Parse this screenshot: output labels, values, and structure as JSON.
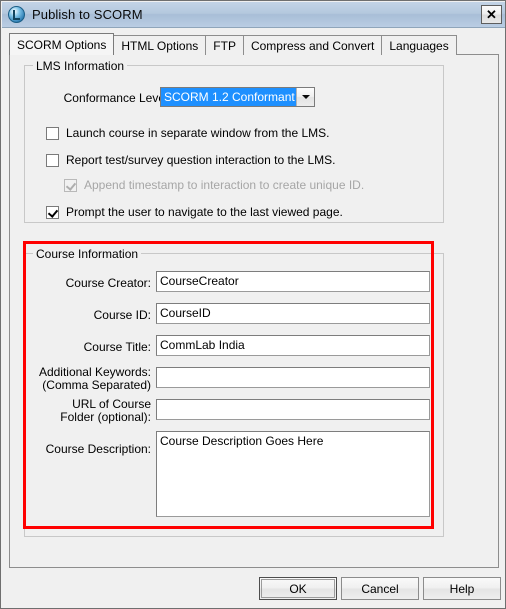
{
  "window": {
    "title": "Publish to SCORM",
    "icon": "app-logo-icon",
    "close_label": "✕"
  },
  "tabs": [
    {
      "label": "SCORM Options",
      "selected": true
    },
    {
      "label": "HTML Options",
      "selected": false
    },
    {
      "label": "FTP",
      "selected": false
    },
    {
      "label": "Compress and Convert",
      "selected": false
    },
    {
      "label": "Languages",
      "selected": false
    }
  ],
  "lms_information": {
    "title": "LMS Information",
    "conformance_label": "Conformance Level:",
    "conformance_value": "SCORM 1.2 Conformant",
    "checkboxes": [
      {
        "label": "Launch course in separate window from the LMS.",
        "checked": false,
        "disabled": false
      },
      {
        "label": "Report test/survey question interaction to the LMS.",
        "checked": false,
        "disabled": false
      },
      {
        "label": "Append timestamp to interaction to create unique ID.",
        "checked": true,
        "disabled": true
      },
      {
        "label": "Prompt the user to navigate to the last viewed page.",
        "checked": true,
        "disabled": false
      }
    ]
  },
  "course_information": {
    "title": "Course Information",
    "fields": [
      {
        "label": "Course Creator:",
        "value": "CourseCreator"
      },
      {
        "label": "Course ID:",
        "value": "CourseID"
      },
      {
        "label": "Course Title:",
        "value": "CommLab India"
      },
      {
        "label_line1": "Additional Keywords:",
        "label_line2": "(Comma Separated)",
        "value": ""
      },
      {
        "label_line1": "URL of Course",
        "label_line2": "Folder (optional):",
        "value": ""
      },
      {
        "label": "Course Description:",
        "value": "Course Description Goes Here"
      }
    ]
  },
  "buttons": {
    "ok": "OK",
    "cancel": "Cancel",
    "help": "Help"
  },
  "colors": {
    "accent_selection": "#1e90ff",
    "annotation": "#ff0000",
    "dialog_face": "#f0f0f0",
    "titlebar": "#b4c8de"
  }
}
